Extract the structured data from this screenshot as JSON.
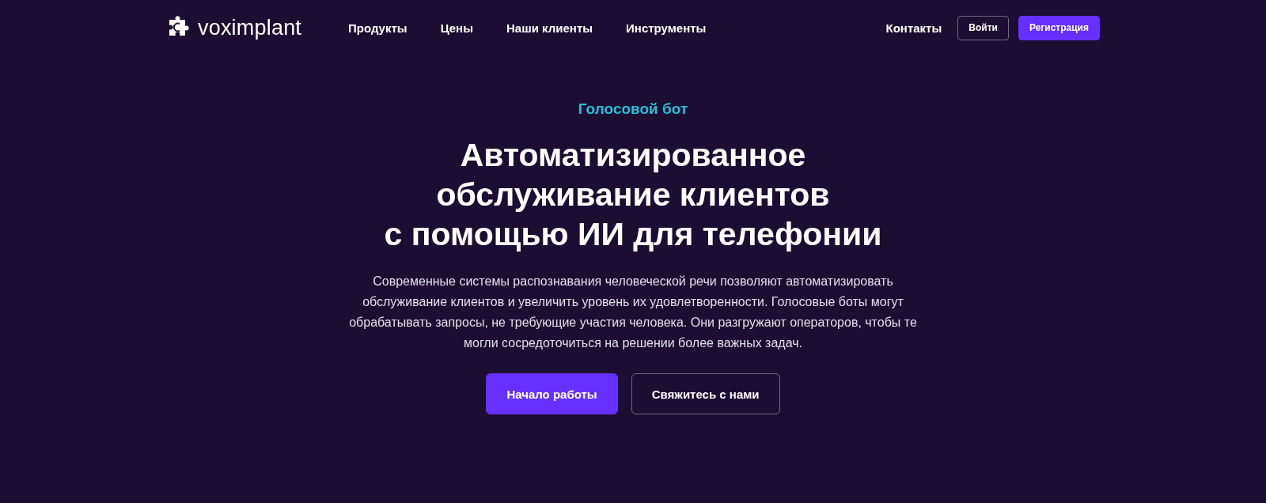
{
  "header": {
    "logo": {
      "text": "voximplant"
    },
    "nav": [
      {
        "label": "Продукты"
      },
      {
        "label": "Цены"
      },
      {
        "label": "Наши клиенты"
      },
      {
        "label": "Инструменты"
      }
    ],
    "contacts": "Контакты",
    "buttons": [
      {
        "label": "Войти",
        "kind": "outline"
      },
      {
        "label": "Регистрация",
        "kind": "primary"
      }
    ]
  },
  "hero": {
    "eyebrow": "Голосовой бот",
    "title": "Автоматизированное\nобслуживание клиентов\nс помощью ИИ для телефонии",
    "description": "Современные системы распознавания человеческой речи позволяют автоматизировать обслуживание клиентов и увеличить уровень их удовлетворенности. Голосовые боты могут обрабатывать запросы, не требующие участия человека. Они разгружают операторов, чтобы те могли сосредоточиться на решении более важных задач.",
    "buttons": [
      {
        "label": "Начало работы",
        "kind": "primary"
      },
      {
        "label": "Свяжитесь с нами",
        "kind": "outline"
      }
    ]
  }
}
